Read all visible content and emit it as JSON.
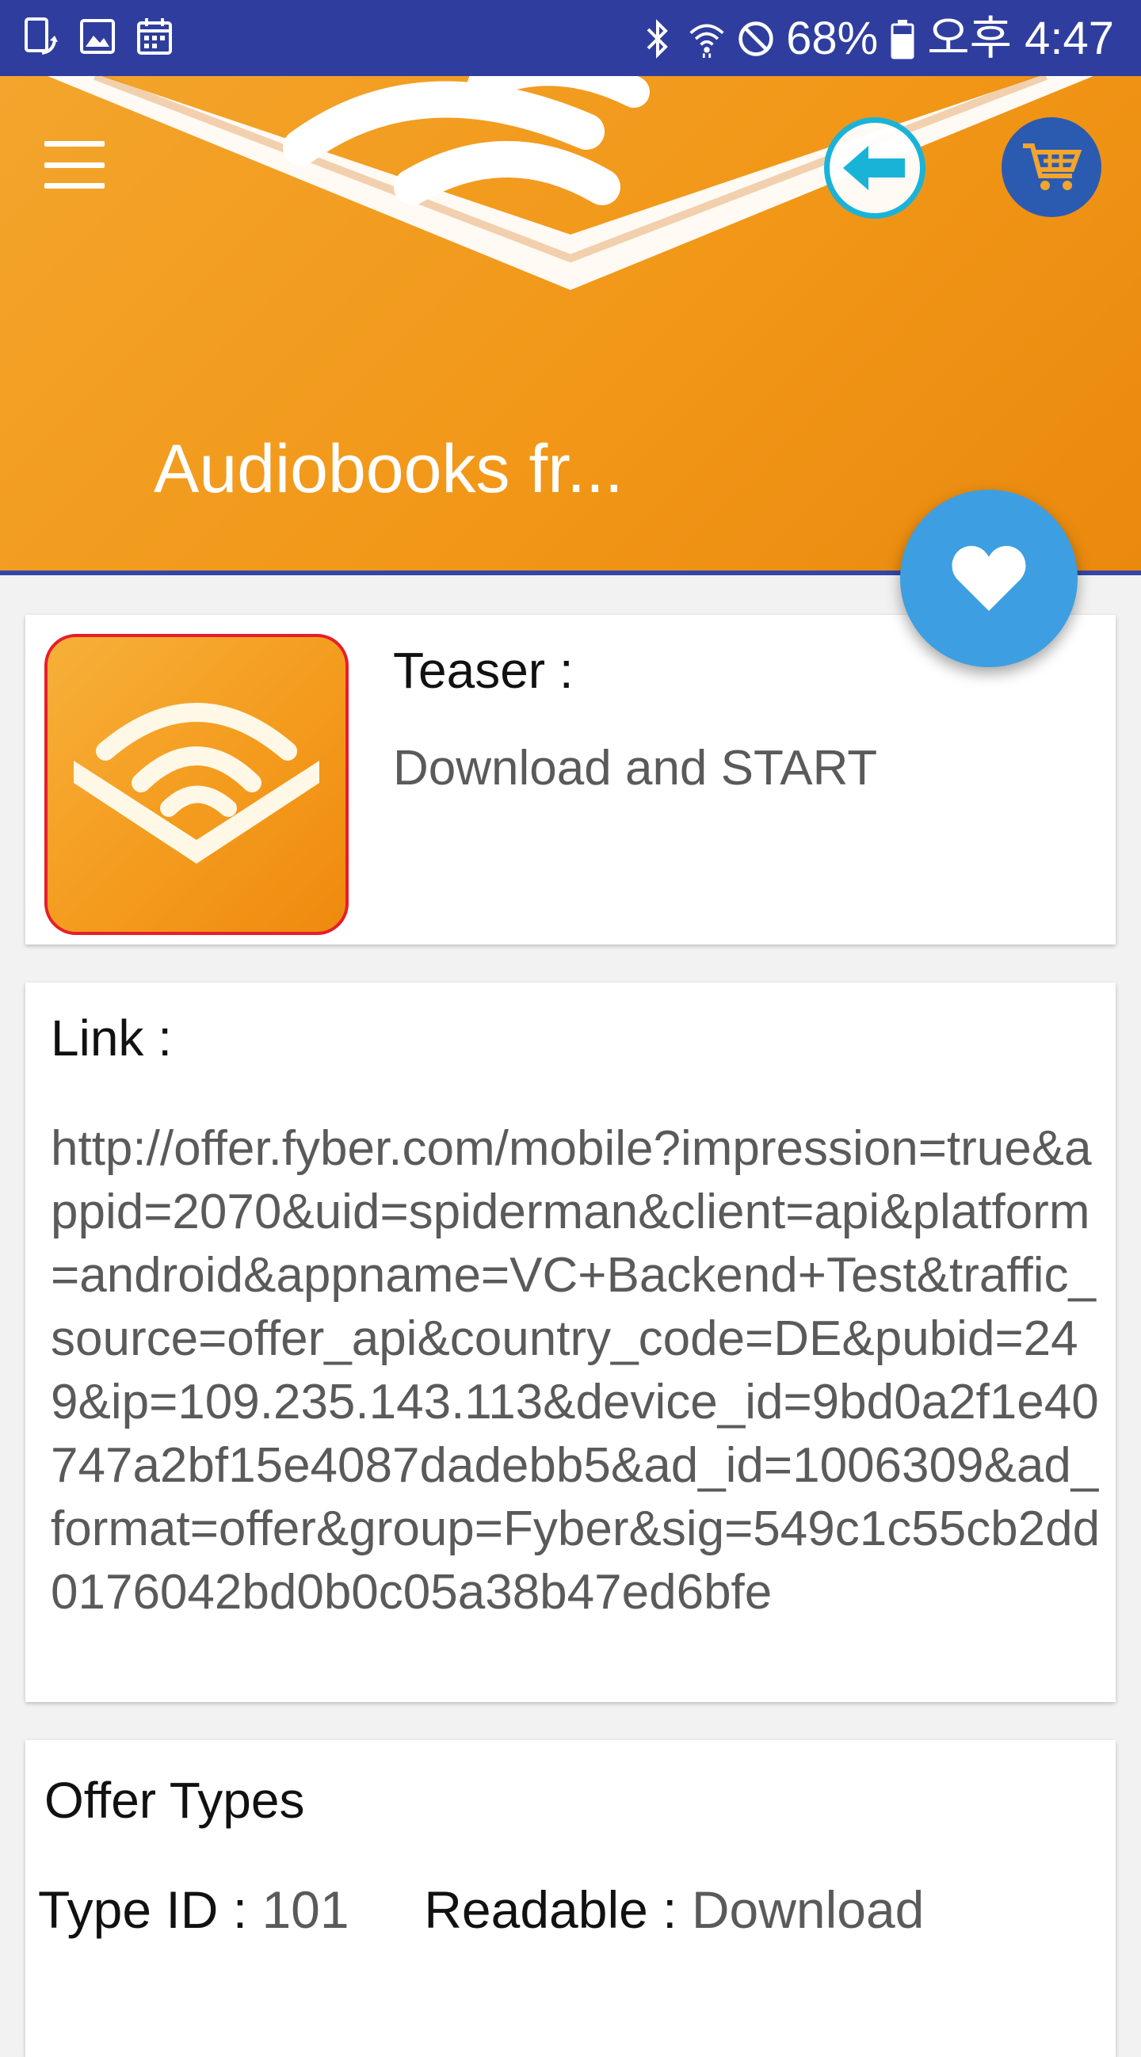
{
  "status_bar": {
    "battery": "68%",
    "time": "오후 4:47",
    "icons": [
      "screen-rotate-icon",
      "image-icon",
      "calendar-icon",
      "bluetooth-icon",
      "wifi-icon",
      "do-not-disturb-icon",
      "battery-icon"
    ]
  },
  "header": {
    "title": "Audiobooks fr...",
    "icons": [
      "menu-icon",
      "arrow-left-icon",
      "shopping-cart-icon",
      "heart-icon"
    ],
    "colors": {
      "banner": "#f29718",
      "bar": "#2f3e9e",
      "back_ring": "#1ab3d8",
      "cart_bg": "#2b5bb1",
      "fab": "#3d9fe2"
    }
  },
  "teaser": {
    "label": "Teaser :",
    "value": "Download and START",
    "icon": "audible-app-icon"
  },
  "link": {
    "label": "Link :",
    "value": "http://offer.fyber.com/mobile?impression=true&appid=2070&uid=spiderman&client=api&platform=android&appname=VC+Backend+Test&traffic_source=offer_api&country_code=DE&pubid=249&ip=109.235.143.113&device_id=9bd0a2f1e40747a2bf15e4087dadebb5&ad_id=1006309&ad_format=offer&group=Fyber&sig=549c1c55cb2dd0176042bd0b0c05a38b47ed6bfe"
  },
  "offer_types": {
    "title": "Offer Types",
    "type_id_label": "Type ID :",
    "type_id_value": "101",
    "readable_label": "Readable :",
    "readable_value": "Download"
  }
}
